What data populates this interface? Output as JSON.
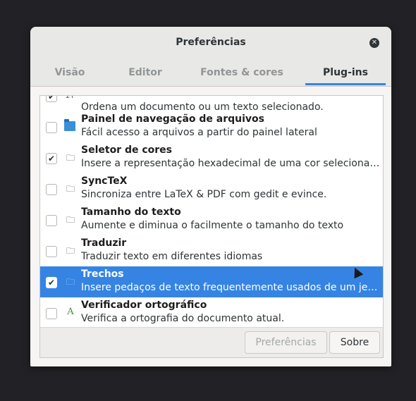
{
  "window": {
    "title": "Preferências"
  },
  "tabs": [
    {
      "label": "Visão"
    },
    {
      "label": "Editor"
    },
    {
      "label": "Fontes & cores"
    },
    {
      "label": "Plug-ins"
    }
  ],
  "plugins": [
    {
      "name": "",
      "description": "Ordena um documento ou um texto selecionado.",
      "checked": true,
      "icon": "sort-icon"
    },
    {
      "name": "Painel de navegação de arquivos",
      "description": "Fácil acesso a arquivos a partir do painel lateral",
      "checked": false,
      "icon": "folder-icon"
    },
    {
      "name": "Seletor de cores",
      "description": "Insere a representação hexadecimal de uma cor selecionada nu…",
      "checked": true,
      "icon": "plugin-icon"
    },
    {
      "name": "SyncTeX",
      "description": "Sincroniza entre LaTeX & PDF com gedit e evince.",
      "checked": false,
      "icon": "plugin-icon"
    },
    {
      "name": "Tamanho do texto",
      "description": "Aumente e diminua o facilmente o tamanho do texto",
      "checked": false,
      "icon": "plugin-icon"
    },
    {
      "name": "Traduzir",
      "description": "Traduzir texto em diferentes idiomas",
      "checked": false,
      "icon": "plugin-icon"
    },
    {
      "name": "Trechos",
      "description": "Insere pedaços de texto frequentemente usados de um jeito ráp…",
      "checked": true,
      "icon": "plugin-icon",
      "selected": true
    },
    {
      "name": "Verificador ortográfico",
      "description": "Verifica a ortografia do documento atual.",
      "checked": false,
      "icon": "spellcheck-icon"
    }
  ],
  "buttons": {
    "preferences": "Preferências",
    "about": "Sobre"
  },
  "colors": {
    "accent": "#3584e4",
    "background": "#222226"
  }
}
